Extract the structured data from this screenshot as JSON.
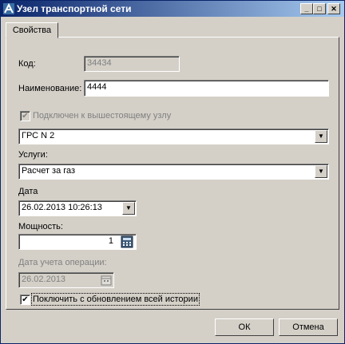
{
  "window": {
    "title": "Узел транспортной сети"
  },
  "tabs": [
    {
      "label": "Свойства"
    }
  ],
  "form": {
    "code_label": "Код:",
    "code_value": "34434",
    "name_label": "Наименование:",
    "name_value": "4444",
    "connected_label": "Подключен к вышестоящему узлу",
    "connected_checked": true,
    "grs_value": "ГРС N 2",
    "services_label": "Услуги:",
    "services_value": "Расчет за газ",
    "date_label": "Дата",
    "date_value": "26.02.2013 10:26:13",
    "power_label": "Мощность:",
    "power_value": "1",
    "op_date_label": "Дата учета операции:",
    "op_date_value": "26.02.2013",
    "connect_history_label": "Поключить с обновлением всей истории",
    "connect_history_checked": true
  },
  "buttons": {
    "ok": "ОК",
    "cancel": "Отмена"
  },
  "colors": {
    "title_start": "#0a246a",
    "title_end": "#a6caf0",
    "face": "#d4d0c8"
  }
}
